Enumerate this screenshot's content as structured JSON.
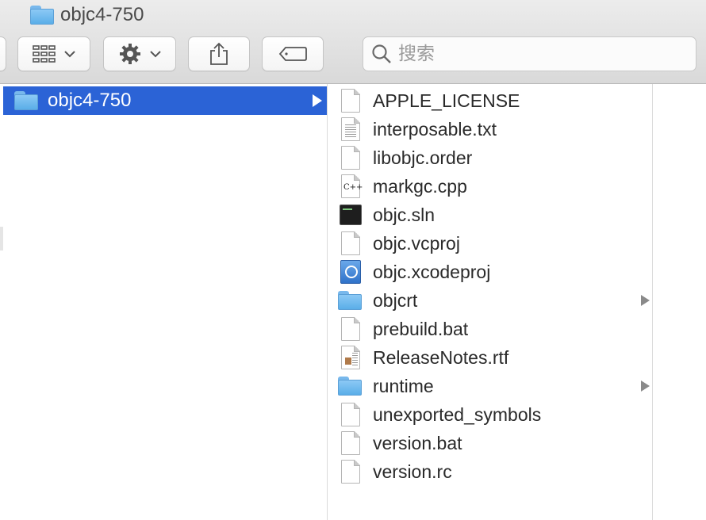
{
  "window": {
    "title": "objc4-750"
  },
  "toolbar": {
    "search_placeholder": "搜索"
  },
  "sidebar_column": {
    "selected": {
      "label": "objc4-750"
    }
  },
  "files": [
    {
      "name": "APPLE_LICENSE",
      "icon": "document-icon"
    },
    {
      "name": "interposable.txt",
      "icon": "text-document-icon"
    },
    {
      "name": "libobjc.order",
      "icon": "document-icon"
    },
    {
      "name": "markgc.cpp",
      "icon": "cpp-file-icon"
    },
    {
      "name": "objc.sln",
      "icon": "terminal-file-icon"
    },
    {
      "name": "objc.vcproj",
      "icon": "document-icon"
    },
    {
      "name": "objc.xcodeproj",
      "icon": "xcode-project-icon"
    },
    {
      "name": "objcrt",
      "icon": "folder-icon"
    },
    {
      "name": "prebuild.bat",
      "icon": "document-icon"
    },
    {
      "name": "ReleaseNotes.rtf",
      "icon": "rtf-document-icon"
    },
    {
      "name": "runtime",
      "icon": "folder-icon"
    },
    {
      "name": "unexported_symbols",
      "icon": "document-icon"
    },
    {
      "name": "version.bat",
      "icon": "document-icon"
    },
    {
      "name": "version.rc",
      "icon": "document-icon"
    }
  ],
  "colors": {
    "selection": "#2b63d6",
    "folder": "#78b8ec"
  }
}
